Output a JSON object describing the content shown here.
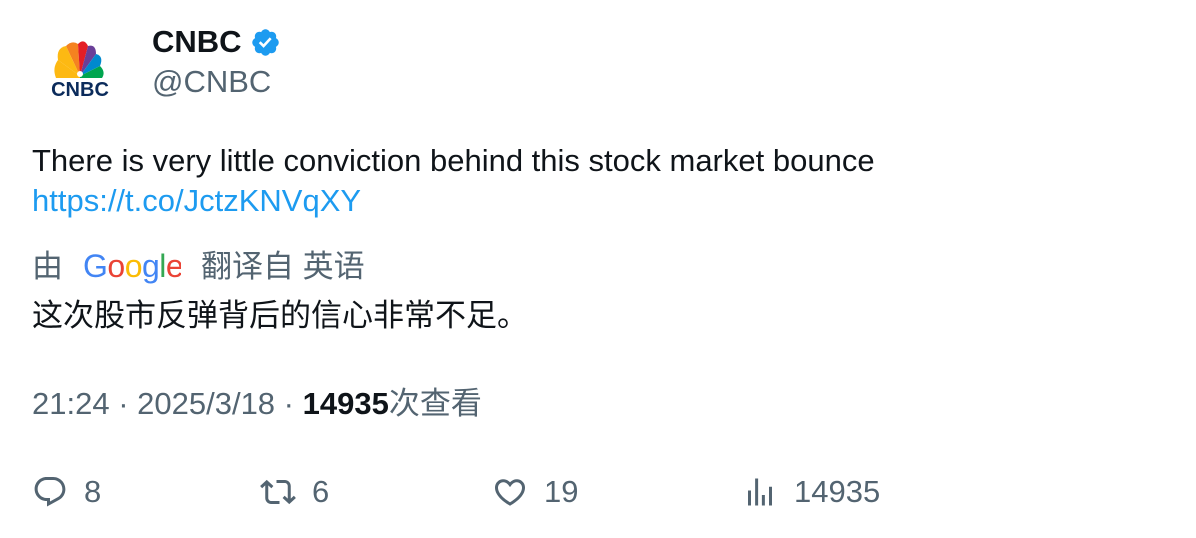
{
  "author": {
    "display_name": "CNBC",
    "handle": "@CNBC",
    "verified": true,
    "avatar_text": "CNBC",
    "verified_color": "#1d9bf0"
  },
  "tweet": {
    "text": "There is very little conviction behind this stock market bounce",
    "link": "https://t.co/JctzKNVqXY"
  },
  "translation": {
    "prefix": "由",
    "provider": "Google",
    "suffix": "翻译自 英语",
    "text": "这次股市反弹背后的信心非常不足。"
  },
  "meta": {
    "time": "21:24",
    "separator": " · ",
    "date": "2025/3/18",
    "views_count": "14935",
    "views_label": "次查看"
  },
  "actions": {
    "reply_count": "8",
    "retweet_count": "6",
    "like_count": "19",
    "views_count": "14935"
  },
  "icons": {
    "reply": "reply-icon",
    "retweet": "retweet-icon",
    "like": "heart-icon",
    "views": "views-chart-icon",
    "verified": "verified-badge-icon"
  },
  "colors": {
    "text": "#0f1419",
    "secondary": "#536471",
    "link": "#1d9bf0"
  }
}
